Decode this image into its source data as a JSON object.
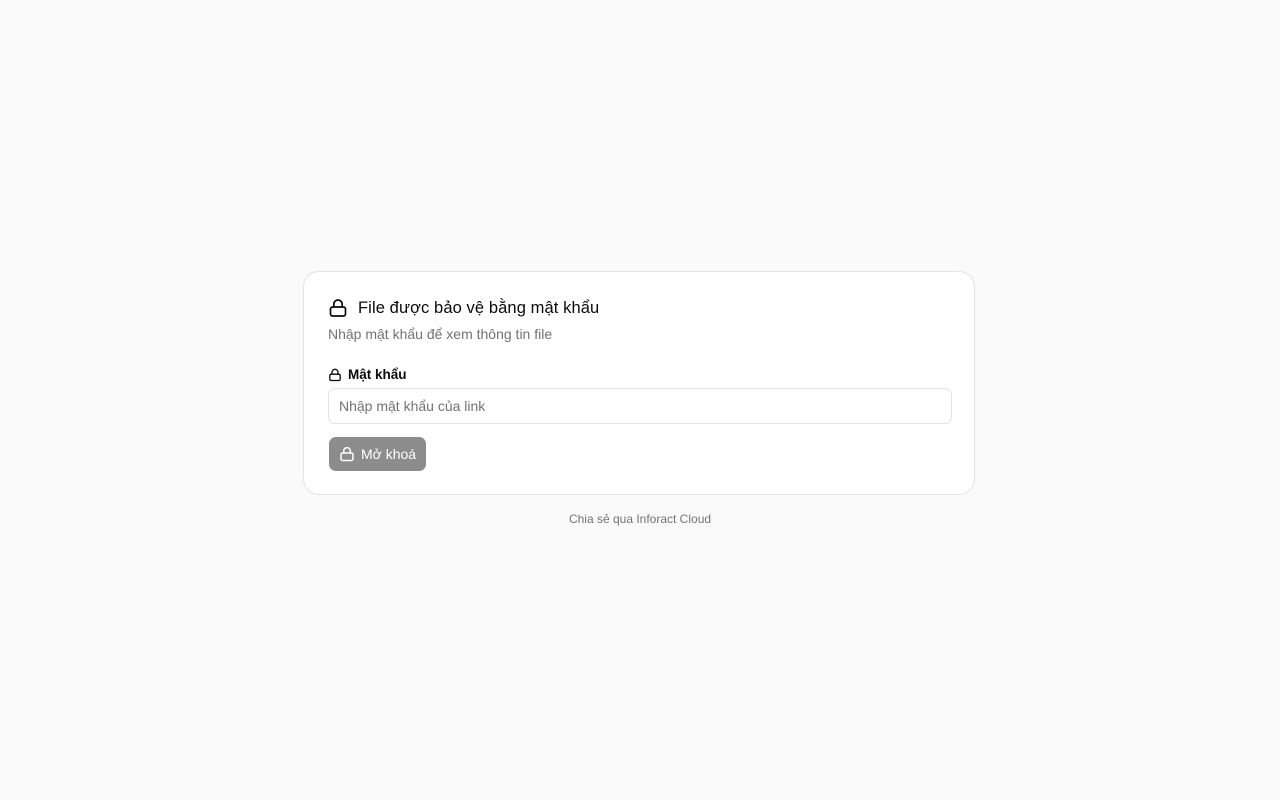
{
  "card": {
    "title": "File được bảo vệ bằng mật khẩu",
    "title_icon": "lock-icon",
    "description": "Nhập mật khẩu để xem thông tin file"
  },
  "password_field": {
    "label": "Mật khẩu",
    "label_icon": "lock-icon",
    "value": "",
    "placeholder": "Nhập mật khẩu của link"
  },
  "unlock_button": {
    "label": "Mở khoá",
    "icon": "lock-icon",
    "color": "#8c8c8c"
  },
  "footer": {
    "text": "Chia sẻ qua Inforact Cloud"
  }
}
